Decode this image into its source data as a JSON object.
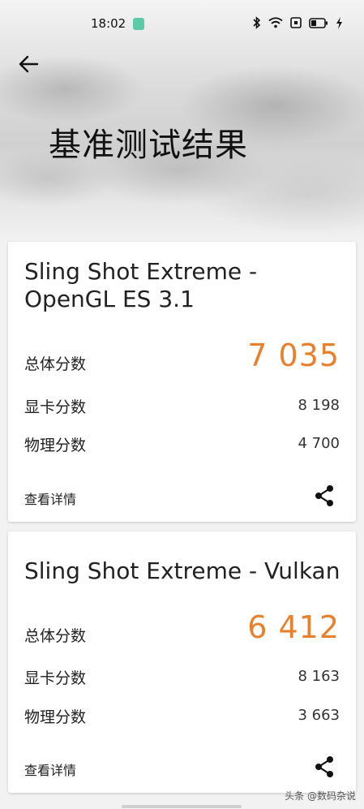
{
  "status_bar": {
    "time": "18:02"
  },
  "header": {
    "title": "基准测试结果"
  },
  "cards": [
    {
      "title": "Sling Shot Extreme - OpenGL ES 3.1",
      "total_label": "总体分数",
      "total_value": "7 035",
      "graphics_label": "显卡分数",
      "graphics_value": "8 198",
      "physics_label": "物理分数",
      "physics_value": "4 700",
      "details_label": "查看详情"
    },
    {
      "title": "Sling Shot Extreme - Vulkan",
      "total_label": "总体分数",
      "total_value": "6 412",
      "graphics_label": "显卡分数",
      "graphics_value": "8 163",
      "physics_label": "物理分数",
      "physics_value": "3 663",
      "details_label": "查看详情"
    }
  ],
  "colors": {
    "accent": "#e8812e"
  },
  "icons": [
    "back-arrow-icon",
    "share-icon",
    "bluetooth-icon",
    "wifi-icon",
    "battery-icon",
    "charging-icon"
  ],
  "watermark": "头条 @数码杂说"
}
